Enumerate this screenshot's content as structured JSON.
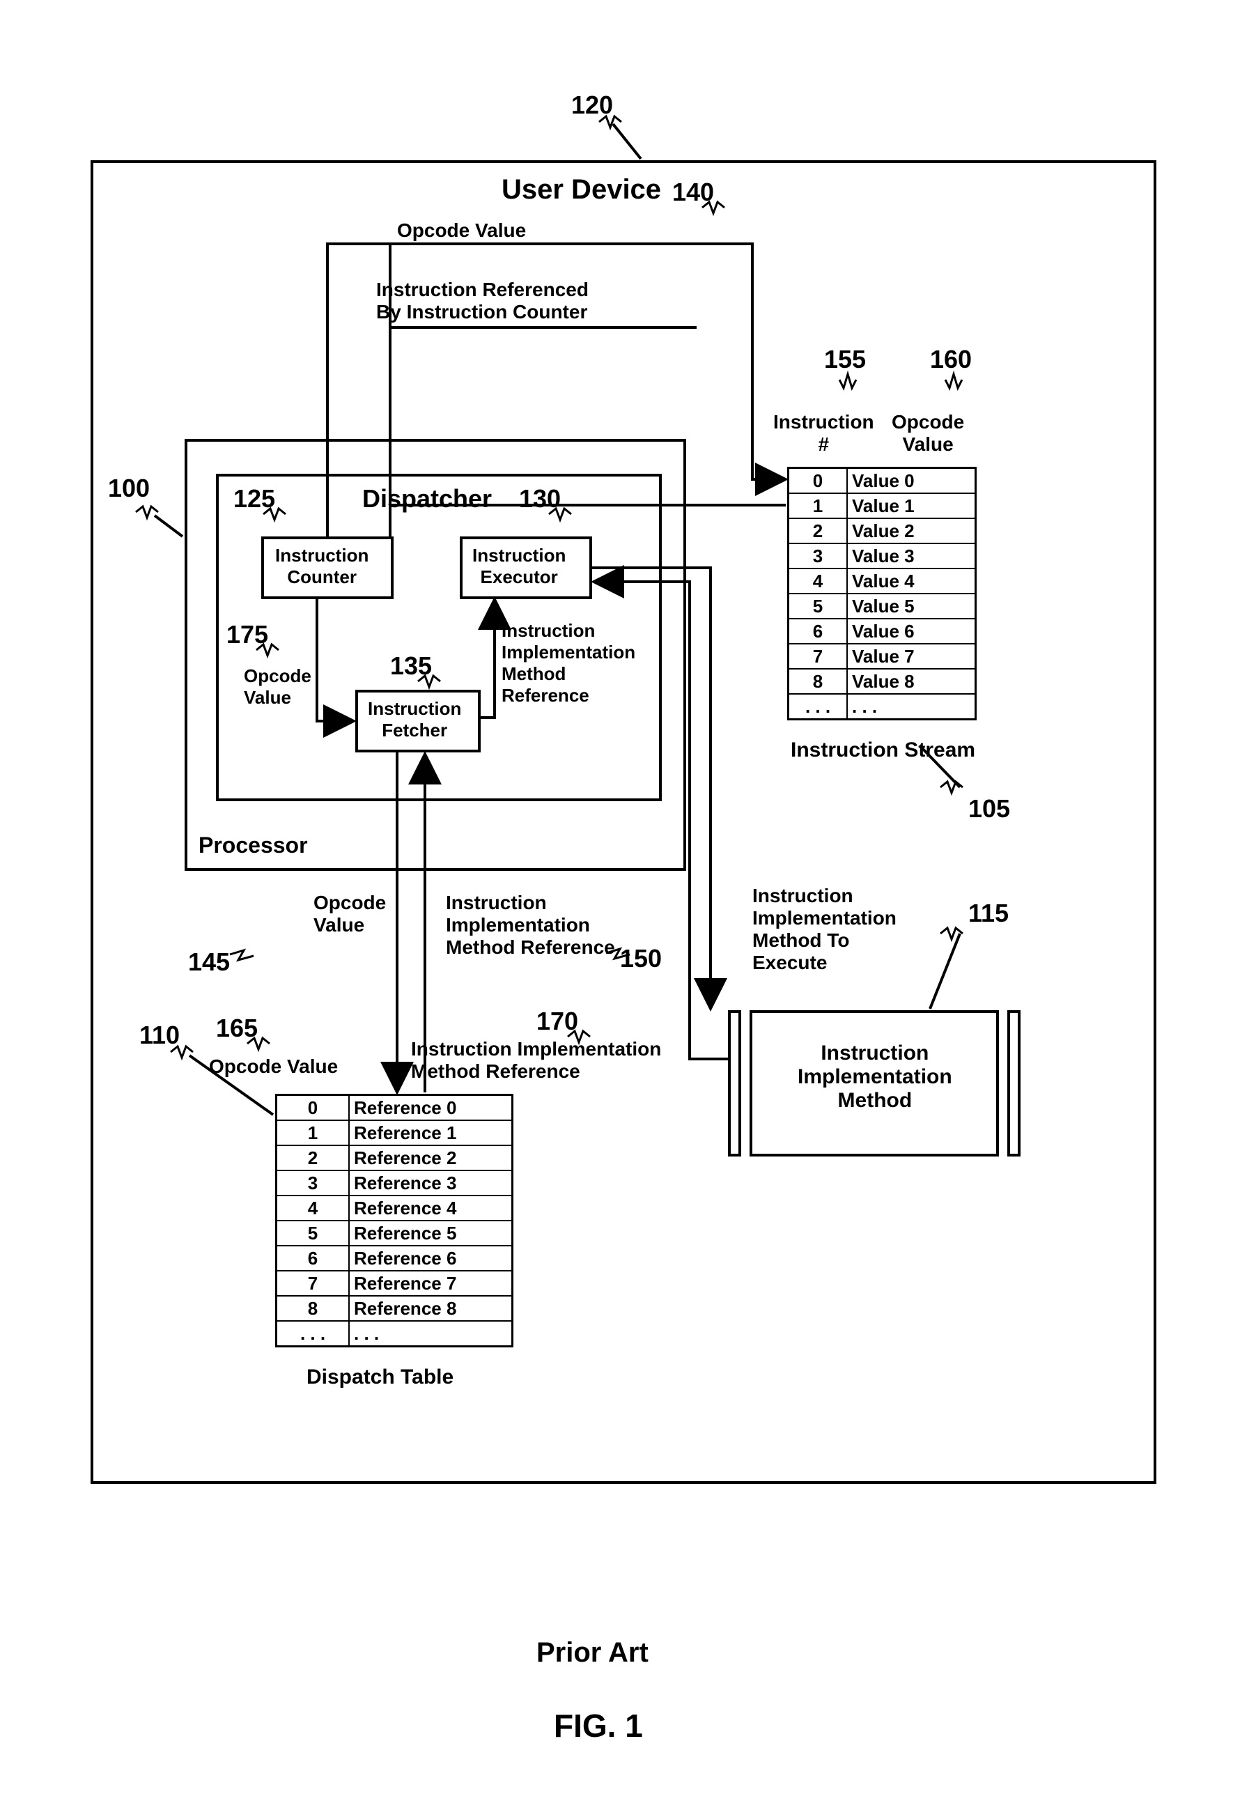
{
  "title": "User Device",
  "fig": "FIG. 1",
  "subtitle": "Prior Art",
  "refs": {
    "r100": "100",
    "r105": "105",
    "r110": "110",
    "r115": "115",
    "r120": "120",
    "r125": "125",
    "r130": "130",
    "r135": "135",
    "r140": "140",
    "r145": "145",
    "r150": "150",
    "r155": "155",
    "r160": "160",
    "r165": "165",
    "r170": "170",
    "r175": "175"
  },
  "labels": {
    "dispatcher": "Dispatcher",
    "processor": "Processor",
    "instr_counter": "Instruction\nCounter",
    "instr_executor": "Instruction\nExecutor",
    "instr_fetcher": "Instruction\nFetcher",
    "opcode_value": "Opcode Value",
    "opcode_value2": "Opcode\nValue",
    "instr_ref_by_counter": "Instruction Referenced\nBy Instruction Counter",
    "instr_impl_ref": "Instruction\nImplementation\nMethod Reference",
    "instr_impl_ref2": "Instruction\nImplementation\nMethod\nReference",
    "instr_impl_ref3": "Instruction Implementation\nMethod Reference",
    "instr_impl_to_exec": "Instruction\nImplementation\nMethod To\nExecute",
    "instr_impl_method": "Instruction\nImplementation\nMethod",
    "instr_stream": "Instruction Stream",
    "dispatch_table": "Dispatch Table",
    "instr_num_hdr": "Instruction\n#",
    "opcode_hdr": "Opcode\nValue"
  },
  "instruction_stream": [
    {
      "n": "0",
      "v": "Value 0"
    },
    {
      "n": "1",
      "v": "Value 1"
    },
    {
      "n": "2",
      "v": "Value 2"
    },
    {
      "n": "3",
      "v": "Value 3"
    },
    {
      "n": "4",
      "v": "Value 4"
    },
    {
      "n": "5",
      "v": "Value 5"
    },
    {
      "n": "6",
      "v": "Value 6"
    },
    {
      "n": "7",
      "v": "Value 7"
    },
    {
      "n": "8",
      "v": "Value 8"
    },
    {
      "n": ". . .",
      "v": ". . ."
    }
  ],
  "dispatch_table": [
    {
      "n": "0",
      "v": "Reference 0"
    },
    {
      "n": "1",
      "v": "Reference 1"
    },
    {
      "n": "2",
      "v": "Reference 2"
    },
    {
      "n": "3",
      "v": "Reference 3"
    },
    {
      "n": "4",
      "v": "Reference 4"
    },
    {
      "n": "5",
      "v": "Reference 5"
    },
    {
      "n": "6",
      "v": "Reference 6"
    },
    {
      "n": "7",
      "v": "Reference 7"
    },
    {
      "n": "8",
      "v": "Reference 8"
    },
    {
      "n": ". . .",
      "v": ". . ."
    }
  ]
}
